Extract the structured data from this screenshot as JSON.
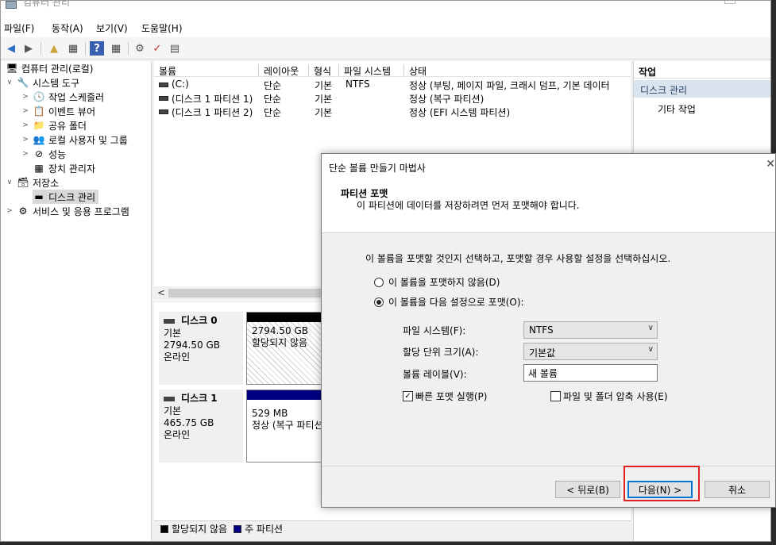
{
  "window": {
    "title": "컴퓨터 관리"
  },
  "menu": [
    "파일(F)",
    "동작(A)",
    "보기(V)",
    "도움말(H)"
  ],
  "tree": {
    "root": "컴퓨터 관리(로컬)",
    "system_tools": "시스템 도구",
    "task_scheduler": "작업 스케줄러",
    "event_viewer": "이벤트 뷰어",
    "shared_folders": "공유 폴더",
    "local_users": "로컬 사용자 및 그룹",
    "performance": "성능",
    "device_manager": "장치 관리자",
    "storage": "저장소",
    "disk_management": "디스크 관리",
    "services": "서비스 및 응용 프로그램"
  },
  "volumes": {
    "headers": [
      "볼륨",
      "레이아웃",
      "형식",
      "파일 시스템",
      "상태"
    ],
    "rows": [
      {
        "volume": "(C:)",
        "layout": "단순",
        "type": "기본",
        "fs": "NTFS",
        "status": "정상 (부팅, 페이지 파일, 크래시 덤프, 기본 데이터"
      },
      {
        "volume": "(디스크 1 파티션 1)",
        "layout": "단순",
        "type": "기본",
        "fs": "",
        "status": "정상 (복구 파티션)"
      },
      {
        "volume": "(디스크 1 파티션 2)",
        "layout": "단순",
        "type": "기본",
        "fs": "",
        "status": "정상 (EFI 시스템 파티션)"
      }
    ]
  },
  "disks": [
    {
      "name": "디스크 0",
      "kind": "기본",
      "size": "2794.50 GB",
      "state": "온라인",
      "part_size": "2794.50 GB",
      "part_status": "할당되지 않음",
      "bar_color": "#000000"
    },
    {
      "name": "디스크 1",
      "kind": "기본",
      "size": "465.75 GB",
      "state": "온라인",
      "part_size": "529 MB",
      "part_status": "정상 (복구 파티션",
      "bar_color": "#000080"
    }
  ],
  "legend": {
    "unallocated": "할당되지 않음",
    "primary": "주 파티션"
  },
  "actions": {
    "header": "작업",
    "section": "디스크 관리",
    "more": "기타 작업"
  },
  "wizard": {
    "title": "단순 볼륨 만들기 마법사",
    "close": "✕",
    "header_title": "파티션 포맷",
    "header_subtitle": "이 파티션에 데이터를 저장하려면 먼저 포맷해야 합니다.",
    "instruction": "이 볼륨을 포맷할 것인지 선택하고, 포맷할 경우 사용할 설정을 선택하십시오.",
    "option_no_format": "이 볼륨을 포맷하지 않음(D)",
    "option_format": "이 볼륨을 다음 설정으로 포맷(O):",
    "fs_label": "파일 시스템(F):",
    "fs_value": "NTFS",
    "alloc_label": "할당 단위 크기(A):",
    "alloc_value": "기본값",
    "volume_label": "볼륨 레이블(V):",
    "volume_value": "새 볼륨",
    "quick_format": "빠른 포맷 실행(P)",
    "compression": "파일 및 폴더 압축 사용(E)",
    "back": "< 뒤로(B)",
    "next": "다음(N) >",
    "cancel": "취소"
  }
}
